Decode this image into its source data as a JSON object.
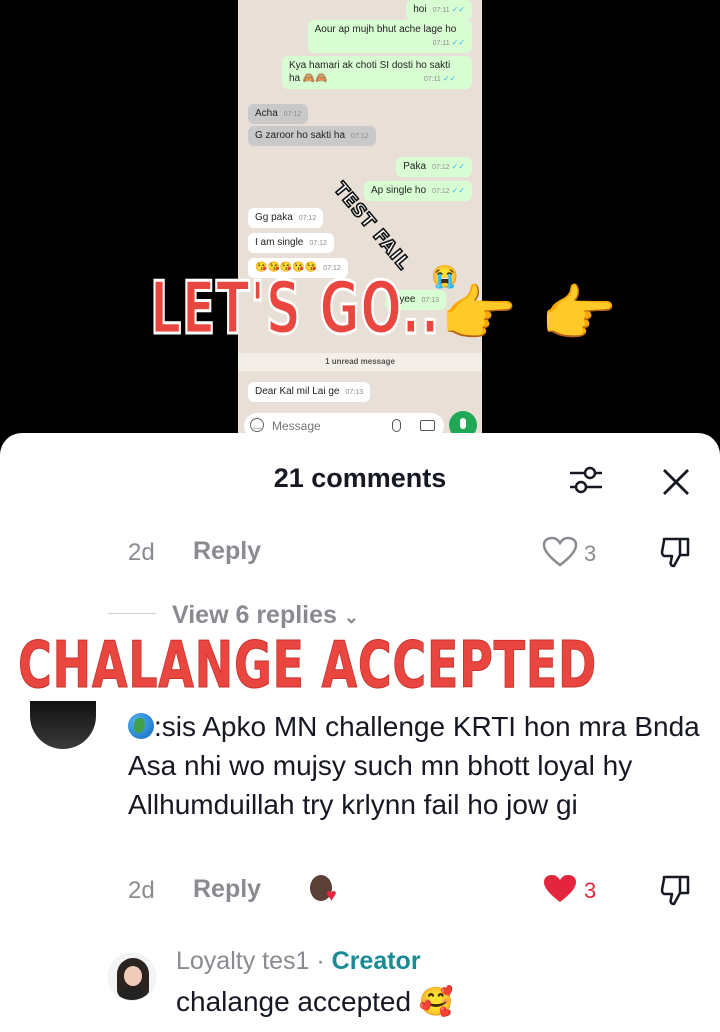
{
  "chat": {
    "messages": [
      {
        "text": "hoi",
        "time": "07:11",
        "dir": "out"
      },
      {
        "text": "Aour ap mujh bhut ache lage ho",
        "time": "07:11",
        "dir": "out"
      },
      {
        "text": "Kya hamari ak choti SI dosti ho sakti",
        "text2": "ha 🙈🙈",
        "time": "07:11",
        "dir": "out"
      },
      {
        "text": "Acha",
        "time": "07:12",
        "dir": "in"
      },
      {
        "text": "G zaroor ho sakti ha",
        "time": "07:12",
        "dir": "in"
      },
      {
        "text": "Paka",
        "time": "07:12",
        "dir": "out"
      },
      {
        "text": "Ap single ho",
        "time": "07:12",
        "dir": "out"
      },
      {
        "text": "Gg paka",
        "time": "07:12",
        "dir": "in"
      },
      {
        "text": "I am single",
        "time": "07:12",
        "dir": "in"
      },
      {
        "text": "😘😘😘😘😘",
        "time": "07:12",
        "dir": "in"
      },
      {
        "text": "Hyee",
        "time": "07:13",
        "dir": "out"
      },
      {
        "text": "Dear Kal mil Lai ge",
        "time": "07:13",
        "dir": "in"
      }
    ],
    "unread_label": "1 unread message",
    "input_placeholder": "Message",
    "tick_mark": "✓✓"
  },
  "overlays": {
    "test_fail": "TEST FAIL",
    "lets_go": "LET'S GO..",
    "pointing_hand": "👉",
    "crying_emoji": "😭",
    "chalange": "CHALANGE ACCEPTED"
  },
  "comments": {
    "title": "21 comments",
    "first": {
      "age": "2d",
      "reply_label": "Reply",
      "likes": "3"
    },
    "view_replies": "View 6 replies",
    "second": {
      "text": ":sis Apko MN challenge KRTI hon mra Bnda Asa nhi wo mujsy such mn bhott loyal hy Allhumduillah try krlynn fail ho jow gi",
      "age": "2d",
      "reply_label": "Reply",
      "likes": "3"
    },
    "creator_reply": {
      "name": "Loyalty tes1",
      "separator": " · ",
      "badge": "Creator",
      "text": "chalange accepted 🥰"
    }
  },
  "colors": {
    "accent_red": "#e8463f",
    "liked_red": "#e3263e",
    "creator_teal": "#1a8a96",
    "chat_out": "#d9fdd3"
  },
  "icons": [
    "filter-icon",
    "close-icon",
    "heart-icon",
    "dislike-icon",
    "globe-icon",
    "chevron-down-icon",
    "mic-icon",
    "attach-icon",
    "camera-icon",
    "emoji-icon"
  ]
}
